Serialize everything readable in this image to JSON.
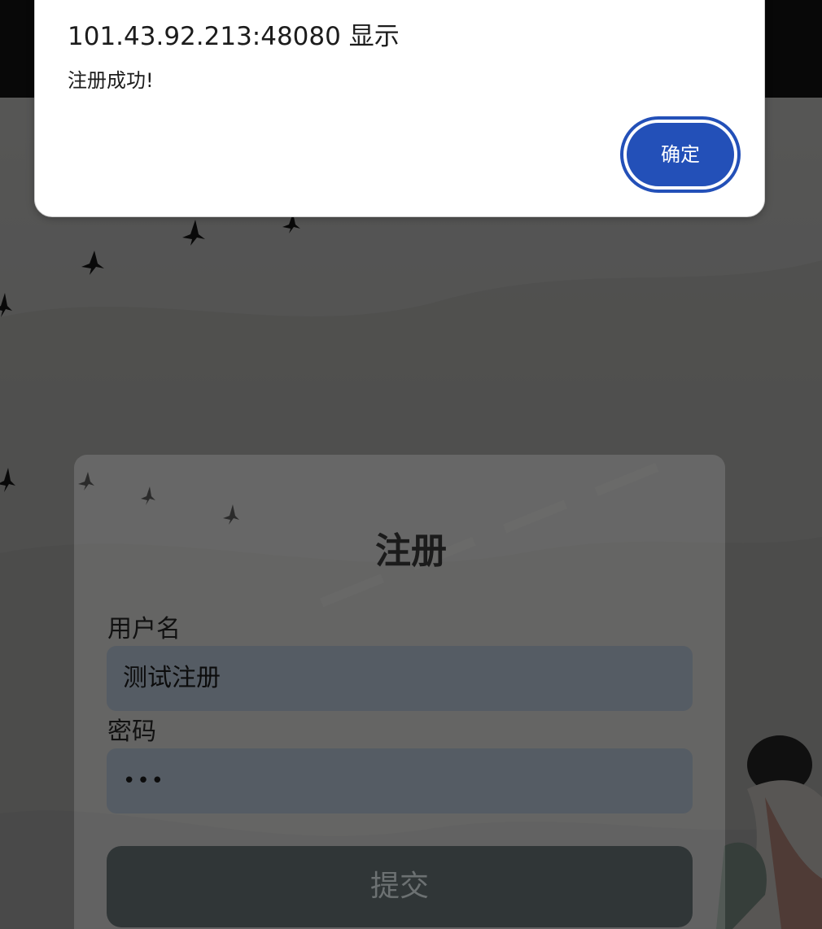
{
  "dialog": {
    "title": "101.43.92.213:48080 显示",
    "message": "注册成功!",
    "ok_label": "确定"
  },
  "form": {
    "title": "注册",
    "username_label": "用户名",
    "username_value": "测试注册",
    "password_label": "密码",
    "password_value": "•••",
    "submit_label": "提交"
  },
  "colors": {
    "dialog_button": "#2350b8",
    "input_bg": "#555c64",
    "submit_bg": "#303637",
    "header_bg": "#171717"
  }
}
